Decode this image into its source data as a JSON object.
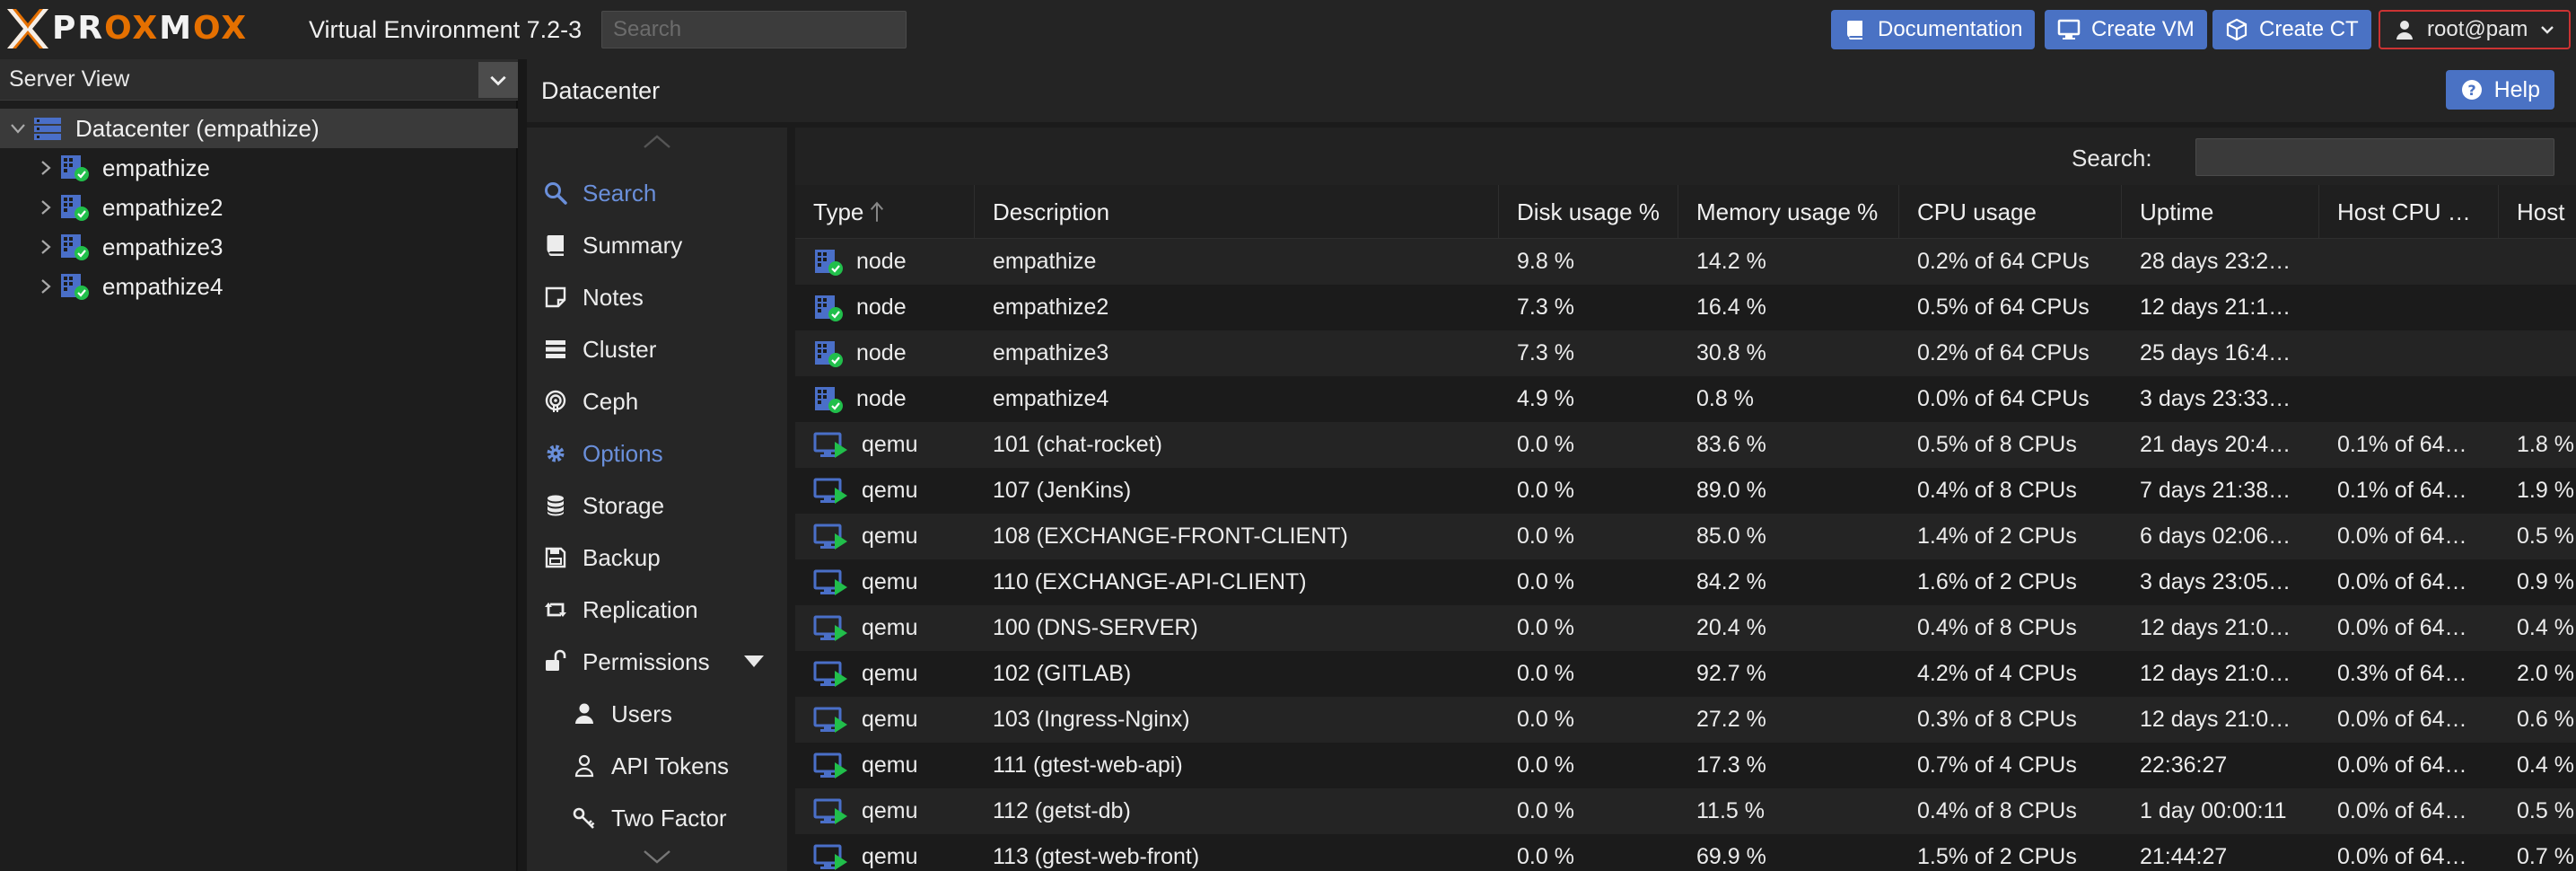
{
  "app": {
    "brand_pre": "PR",
    "brand_ox1": "OX",
    "brand_m": "M",
    "brand_ox2": "OX",
    "version": "Virtual Environment 7.2-3",
    "search_placeholder": "Search"
  },
  "toolbar": {
    "documentation": "Documentation",
    "create_vm": "Create VM",
    "create_ct": "Create CT",
    "user": "root@pam"
  },
  "left": {
    "view": "Server View",
    "datacenter": "Datacenter (empathize)",
    "nodes": [
      "empathize",
      "empathize2",
      "empathize3",
      "empathize4"
    ]
  },
  "content": {
    "title": "Datacenter",
    "help": "Help"
  },
  "nav": {
    "items": [
      {
        "label": "Search",
        "icon": "search-icon"
      },
      {
        "label": "Summary",
        "icon": "book-icon"
      },
      {
        "label": "Notes",
        "icon": "note-icon"
      },
      {
        "label": "Cluster",
        "icon": "server-icon"
      },
      {
        "label": "Ceph",
        "icon": "ceph-icon"
      },
      {
        "label": "Options",
        "icon": "gear-icon"
      },
      {
        "label": "Storage",
        "icon": "database-icon"
      },
      {
        "label": "Backup",
        "icon": "floppy-icon"
      },
      {
        "label": "Replication",
        "icon": "retweet-icon"
      },
      {
        "label": "Permissions",
        "icon": "unlock-icon"
      },
      {
        "label": "Users",
        "icon": "user-icon"
      },
      {
        "label": "API Tokens",
        "icon": "user-outline-icon"
      },
      {
        "label": "Two Factor",
        "icon": "key-icon"
      }
    ]
  },
  "grid": {
    "search_label": "Search:",
    "columns": [
      "Type",
      "Description",
      "Disk usage %",
      "Memory usage %",
      "CPU usage",
      "Uptime",
      "Host CPU …",
      "Host"
    ],
    "rows": [
      {
        "type": "node",
        "desc": "empathize",
        "disk": "9.8 %",
        "mem": "14.2 %",
        "cpu": "0.2% of 64 CPUs",
        "uptime": "28 days 23:2…",
        "hostcpu": "",
        "hostmem": ""
      },
      {
        "type": "node",
        "desc": "empathize2",
        "disk": "7.3 %",
        "mem": "16.4 %",
        "cpu": "0.5% of 64 CPUs",
        "uptime": "12 days 21:1…",
        "hostcpu": "",
        "hostmem": ""
      },
      {
        "type": "node",
        "desc": "empathize3",
        "disk": "7.3 %",
        "mem": "30.8 %",
        "cpu": "0.2% of 64 CPUs",
        "uptime": "25 days 16:4…",
        "hostcpu": "",
        "hostmem": ""
      },
      {
        "type": "node",
        "desc": "empathize4",
        "disk": "4.9 %",
        "mem": "0.8 %",
        "cpu": "0.0% of 64 CPUs",
        "uptime": "3 days 23:33…",
        "hostcpu": "",
        "hostmem": ""
      },
      {
        "type": "qemu",
        "desc": "101 (chat-rocket)",
        "disk": "0.0 %",
        "mem": "83.6 %",
        "cpu": "0.5% of 8 CPUs",
        "uptime": "21 days 20:4…",
        "hostcpu": "0.1% of 64…",
        "hostmem": "1.8 %"
      },
      {
        "type": "qemu",
        "desc": "107 (JenKins)",
        "disk": "0.0 %",
        "mem": "89.0 %",
        "cpu": "0.4% of 8 CPUs",
        "uptime": "7 days 21:38…",
        "hostcpu": "0.1% of 64…",
        "hostmem": "1.9 %"
      },
      {
        "type": "qemu",
        "desc": "108 (EXCHANGE-FRONT-CLIENT)",
        "disk": "0.0 %",
        "mem": "85.0 %",
        "cpu": "1.4% of 2 CPUs",
        "uptime": "6 days 02:06…",
        "hostcpu": "0.0% of 64…",
        "hostmem": "0.5 %"
      },
      {
        "type": "qemu",
        "desc": "110 (EXCHANGE-API-CLIENT)",
        "disk": "0.0 %",
        "mem": "84.2 %",
        "cpu": "1.6% of 2 CPUs",
        "uptime": "3 days 23:05…",
        "hostcpu": "0.0% of 64…",
        "hostmem": "0.9 %"
      },
      {
        "type": "qemu",
        "desc": "100 (DNS-SERVER)",
        "disk": "0.0 %",
        "mem": "20.4 %",
        "cpu": "0.4% of 8 CPUs",
        "uptime": "12 days 21:0…",
        "hostcpu": "0.0% of 64…",
        "hostmem": "0.4 %"
      },
      {
        "type": "qemu",
        "desc": "102 (GITLAB)",
        "disk": "0.0 %",
        "mem": "92.7 %",
        "cpu": "4.2% of 4 CPUs",
        "uptime": "12 days 21:0…",
        "hostcpu": "0.3% of 64…",
        "hostmem": "2.0 %"
      },
      {
        "type": "qemu",
        "desc": "103 (Ingress-Nginx)",
        "disk": "0.0 %",
        "mem": "27.2 %",
        "cpu": "0.3% of 8 CPUs",
        "uptime": "12 days 21:0…",
        "hostcpu": "0.0% of 64…",
        "hostmem": "0.6 %"
      },
      {
        "type": "qemu",
        "desc": "111 (gtest-web-api)",
        "disk": "0.0 %",
        "mem": "17.3 %",
        "cpu": "0.7% of 4 CPUs",
        "uptime": "22:36:27",
        "hostcpu": "0.0% of 64…",
        "hostmem": "0.4 %"
      },
      {
        "type": "qemu",
        "desc": "112 (getst-db)",
        "disk": "0.0 %",
        "mem": "11.5 %",
        "cpu": "0.4% of 8 CPUs",
        "uptime": "1 day 00:00:11",
        "hostcpu": "0.0% of 64…",
        "hostmem": "0.5 %"
      },
      {
        "type": "qemu",
        "desc": "113 (gtest-web-front)",
        "disk": "0.0 %",
        "mem": "69.9 %",
        "cpu": "1.5% of 2 CPUs",
        "uptime": "21:44:27",
        "hostcpu": "0.0% of 64…",
        "hostmem": "0.7 %"
      }
    ]
  },
  "colors": {
    "accent": "#4a72c4",
    "brand_orange": "#e57000",
    "active_nav": "#6a8fda",
    "status_ok": "#21bf4b",
    "node_blue": "#4a6fc8"
  }
}
